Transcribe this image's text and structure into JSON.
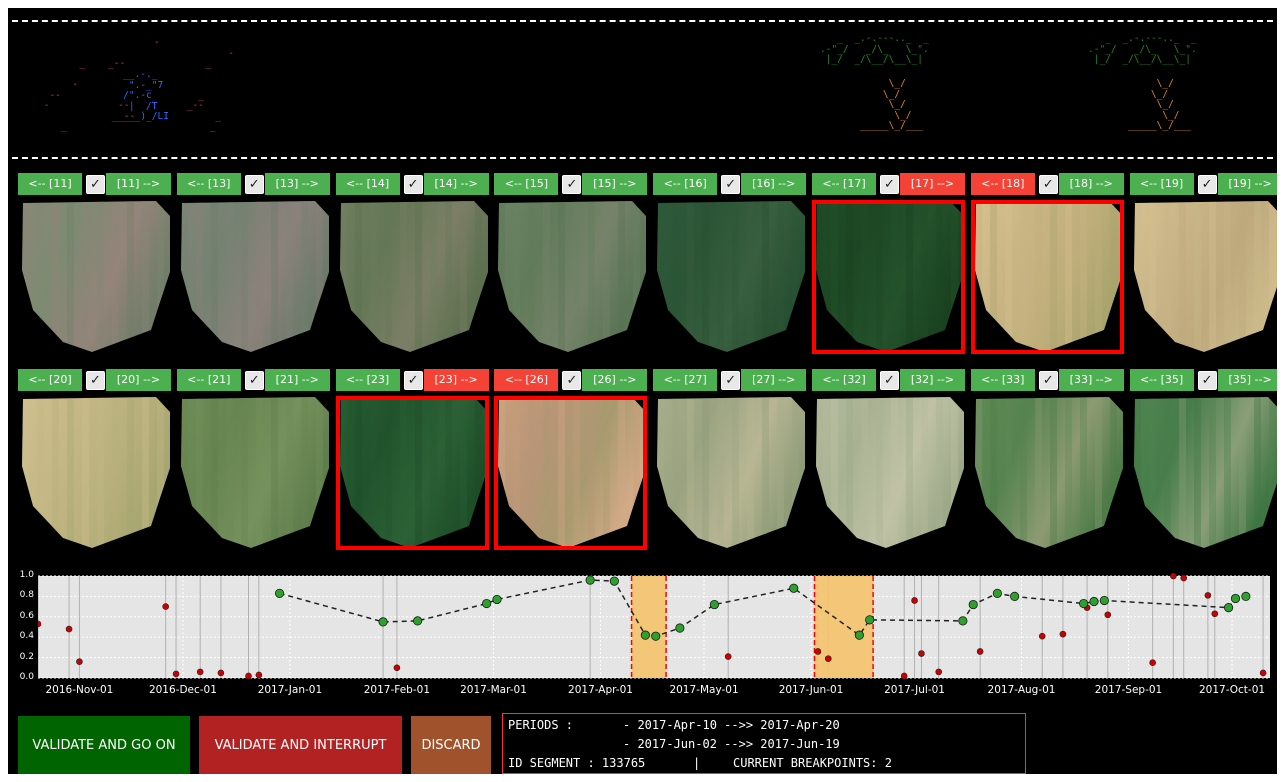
{
  "thumbnails": [
    {
      "prev_label": "<-- [11]",
      "next_label": "[11] -->",
      "checked": true,
      "prev_color": "green",
      "next_color": "green",
      "selected": false,
      "palette": [
        "#8a8777",
        "#7d8a72",
        "#94847a",
        "#717d68"
      ]
    },
    {
      "prev_label": "<-- [13]",
      "next_label": "[13] -->",
      "checked": true,
      "prev_color": "green",
      "next_color": "green",
      "selected": false,
      "palette": [
        "#818578",
        "#748271",
        "#8c827c",
        "#6c7a6a"
      ]
    },
    {
      "prev_label": "<-- [14]",
      "next_label": "[14] -->",
      "checked": true,
      "prev_color": "green",
      "next_color": "green",
      "selected": false,
      "palette": [
        "#6e7e5e",
        "#647756",
        "#7c7f66",
        "#5d7050"
      ]
    },
    {
      "prev_label": "<-- [15]",
      "next_label": "[15] -->",
      "checked": true,
      "prev_color": "green",
      "next_color": "green",
      "selected": false,
      "palette": [
        "#6b8364",
        "#627b5a",
        "#76836a",
        "#5a7455"
      ]
    },
    {
      "prev_label": "<-- [16]",
      "next_label": "[16] -->",
      "checked": true,
      "prev_color": "green",
      "next_color": "green",
      "selected": false,
      "palette": [
        "#2f5a3a",
        "#2b5536",
        "#385f3f",
        "#274f31"
      ]
    },
    {
      "prev_label": "<-- [17]",
      "next_label": "[17] -->",
      "checked": true,
      "prev_color": "green",
      "next_color": "red",
      "selected": true,
      "palette": [
        "#1f4c26",
        "#1d4723",
        "#24522b",
        "#1a4220"
      ]
    },
    {
      "prev_label": "<-- [18]",
      "next_label": "[18] -->",
      "checked": true,
      "prev_color": "red",
      "next_color": "green",
      "selected": true,
      "palette": [
        "#d8c08f",
        "#c9b584",
        "#bfae7a",
        "#a9a46d"
      ]
    },
    {
      "prev_label": "<-- [19]",
      "next_label": "[19] -->",
      "checked": true,
      "prev_color": "green",
      "next_color": "green",
      "selected": false,
      "palette": [
        "#d6c091",
        "#c8b487",
        "#bda97c",
        "#cbb98a"
      ]
    },
    {
      "prev_label": "<-- [20]",
      "next_label": "[20] -->",
      "checked": true,
      "prev_color": "green",
      "next_color": "green",
      "selected": false,
      "palette": [
        "#cfc08e",
        "#c4b886",
        "#b8b07c",
        "#a7a670"
      ]
    },
    {
      "prev_label": "<-- [21]",
      "next_label": "[21] -->",
      "checked": true,
      "prev_color": "green",
      "next_color": "green",
      "selected": false,
      "palette": [
        "#6e8c57",
        "#668551",
        "#76915d",
        "#5e7d4b"
      ]
    },
    {
      "prev_label": "<-- [23]",
      "next_label": "[23] -->",
      "checked": true,
      "prev_color": "green",
      "next_color": "red",
      "selected": true,
      "palette": [
        "#255a30",
        "#21542c",
        "#2c6136",
        "#1e4e28"
      ]
    },
    {
      "prev_label": "<-- [26]",
      "next_label": "[26] -->",
      "checked": true,
      "prev_color": "red",
      "next_color": "green",
      "selected": true,
      "palette": [
        "#c79f7c",
        "#b89577",
        "#a89a6f",
        "#d1aa86"
      ]
    },
    {
      "prev_label": "<-- [27]",
      "next_label": "[27] -->",
      "checked": true,
      "prev_color": "green",
      "next_color": "green",
      "selected": false,
      "palette": [
        "#a6ad8a",
        "#9aa381",
        "#b8b693",
        "#8e9c77"
      ]
    },
    {
      "prev_label": "<-- [32]",
      "next_label": "[32] -->",
      "checked": true,
      "prev_color": "green",
      "next_color": "green",
      "selected": false,
      "palette": [
        "#b4bb9c",
        "#a8b292",
        "#c0c2a5",
        "#9ca989"
      ]
    },
    {
      "prev_label": "<-- [33]",
      "next_label": "[33] -->",
      "checked": true,
      "prev_color": "green",
      "next_color": "green",
      "selected": false,
      "palette": [
        "#5f8a55",
        "#568350",
        "#8d9a72",
        "#4e7b48"
      ]
    },
    {
      "prev_label": "<-- [35]",
      "next_label": "[35] -->",
      "checked": true,
      "prev_color": "green",
      "next_color": "green",
      "selected": false,
      "palette": [
        "#4f8450",
        "#477d4a",
        "#8a9e77",
        "#3f7643"
      ]
    }
  ],
  "chart_data": {
    "type": "line",
    "ylim": [
      0,
      1.0
    ],
    "yticks": [
      0.0,
      0.2,
      0.4,
      0.6,
      0.8,
      1.0
    ],
    "xlim": [
      "2016-10-20",
      "2017-10-12"
    ],
    "xticks": [
      "2016-Nov-01",
      "2016-Dec-01",
      "2017-Jan-01",
      "2017-Feb-01",
      "2017-Mar-01",
      "2017-Apr-01",
      "2017-May-01",
      "2017-Jun-01",
      "2017-Jul-01",
      "2017-Aug-01",
      "2017-Sep-01",
      "2017-Oct-01"
    ],
    "grid": true,
    "selected_series": {
      "name": "",
      "color": "#2ea02e",
      "points": [
        [
          "2016-Dec-29",
          0.83
        ],
        [
          "2017-Jan-28",
          0.55
        ],
        [
          "2017-Feb-07",
          0.56
        ],
        [
          "2017-Feb-27",
          0.73
        ],
        [
          "2017-Mar-02",
          0.77
        ],
        [
          "2017-Mar-29",
          0.96
        ],
        [
          "2017-Apr-05",
          0.95
        ],
        [
          "2017-Apr-14",
          0.42
        ],
        [
          "2017-Apr-17",
          0.41
        ],
        [
          "2017-Apr-24",
          0.49
        ],
        [
          "2017-May-04",
          0.72
        ],
        [
          "2017-May-27",
          0.88
        ],
        [
          "2017-Jun-15",
          0.42
        ],
        [
          "2017-Jun-18",
          0.57
        ],
        [
          "2017-Jul-15",
          0.56
        ],
        [
          "2017-Jul-18",
          0.72
        ],
        [
          "2017-Jul-25",
          0.83
        ],
        [
          "2017-Jul-30",
          0.8
        ],
        [
          "2017-Aug-19",
          0.73
        ],
        [
          "2017-Aug-22",
          0.75
        ],
        [
          "2017-Aug-25",
          0.76
        ],
        [
          "2017-Sep-30",
          0.69
        ],
        [
          "2017-Oct-02",
          0.78
        ],
        [
          "2017-Oct-05",
          0.8
        ]
      ]
    },
    "other_series": {
      "name": "",
      "color": "#cc0000",
      "points": [
        [
          "2016-Oct-20",
          0.53
        ],
        [
          "2016-Oct-29",
          0.48
        ],
        [
          "2016-Nov-01",
          0.16
        ],
        [
          "2016-Nov-26",
          0.7
        ],
        [
          "2016-Nov-29",
          0.04
        ],
        [
          "2016-Dec-06",
          0.06
        ],
        [
          "2016-Dec-12",
          0.05
        ],
        [
          "2016-Dec-20",
          0.02
        ],
        [
          "2016-Dec-23",
          0.03
        ],
        [
          "2017-Feb-01",
          0.1
        ],
        [
          "2017-May-08",
          0.21
        ],
        [
          "2017-Jun-03",
          0.26
        ],
        [
          "2017-Jun-06",
          0.19
        ],
        [
          "2017-Jun-28",
          0.02
        ],
        [
          "2017-Jul-01",
          0.76
        ],
        [
          "2017-Jul-03",
          0.24
        ],
        [
          "2017-Jul-08",
          0.06
        ],
        [
          "2017-Jul-20",
          0.26
        ],
        [
          "2017-Aug-07",
          0.41
        ],
        [
          "2017-Aug-13",
          0.43
        ],
        [
          "2017-Aug-20",
          0.69
        ],
        [
          "2017-Aug-26",
          0.62
        ],
        [
          "2017-Sep-08",
          0.15
        ],
        [
          "2017-Sep-14",
          1.0
        ],
        [
          "2017-Sep-17",
          0.98
        ],
        [
          "2017-Sep-24",
          0.81
        ],
        [
          "2017-Sep-26",
          0.63
        ],
        [
          "2017-Oct-10",
          0.05
        ]
      ]
    },
    "highlight_periods": [
      [
        "2017-Apr-10",
        "2017-Apr-20"
      ],
      [
        "2017-Jun-02",
        "2017-Jun-19"
      ]
    ],
    "vertical_lines": [
      "2016-Oct-20",
      "2016-Oct-29",
      "2016-Nov-01",
      "2016-Nov-26",
      "2016-Nov-29",
      "2016-Dec-06",
      "2016-Dec-12",
      "2016-Dec-20",
      "2016-Dec-23",
      "2017-Jan-28",
      "2017-Feb-01",
      "2017-Mar-29",
      "2017-May-08",
      "2017-Jun-03",
      "2017-Jun-06",
      "2017-Jun-28",
      "2017-Jul-01",
      "2017-Jul-03",
      "2017-Jul-08",
      "2017-Jul-20",
      "2017-Aug-07",
      "2017-Aug-13",
      "2017-Aug-20",
      "2017-Aug-26",
      "2017-Sep-08",
      "2017-Sep-14",
      "2017-Sep-17",
      "2017-Sep-24",
      "2017-Sep-26",
      "2017-Oct-10"
    ],
    "highlight_color": "#f5c36b",
    "break_color": "#ff0000"
  },
  "actions": {
    "validate_go_on": "VALIDATE AND GO ON",
    "validate_interrupt": "VALIDATE AND INTERRUPT",
    "discard": "DISCARD"
  },
  "info": {
    "periods_label": "PERIODS :",
    "period_1": "- 2017-Apr-10 -->> 2017-Apr-20",
    "period_2": "- 2017-Jun-02 -->> 2017-Jun-19",
    "id_segment": "ID SEGMENT : 133765",
    "separator": "|",
    "breakpoints": "CURRENT BREAKPOINTS: 2"
  },
  "colors": {
    "green_button": "#4caf50",
    "red_button": "#f44336",
    "go_on": "#006400",
    "interrupt": "#b22222",
    "discard": "#a0522d",
    "selection": "#ff0000"
  }
}
